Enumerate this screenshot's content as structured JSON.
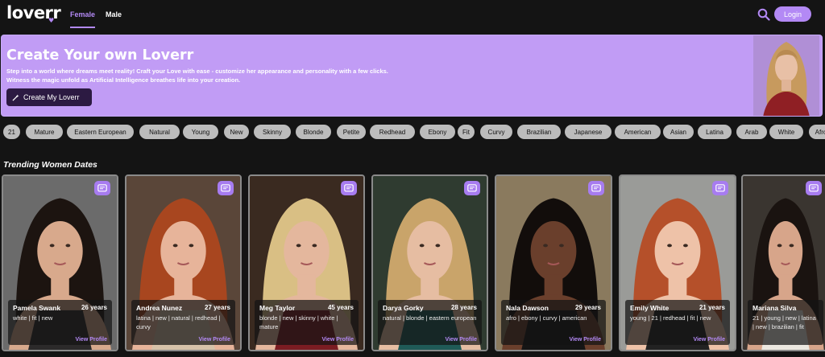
{
  "brand": {
    "logo": "loverr"
  },
  "nav": {
    "tabs": [
      "Female",
      "Male"
    ],
    "active": "Female",
    "login_label": "Login"
  },
  "hero": {
    "title": "Create Your own Loverr",
    "line1": "Step into a world where dreams meet reality! Craft your Love with ease - customize her appearance and personality with a few clicks.",
    "line2": "Witness the magic unfold as Artificial Intelligence breathes life into your creation.",
    "cta_label": "Create My Loverr"
  },
  "filters": [
    "21",
    "Mature",
    "Eastern European",
    "Natural",
    "Young",
    "New",
    "Skinny",
    "Blonde",
    "Petite",
    "Redhead",
    "Ebony",
    "Fit",
    "Curvy",
    "Brazilian",
    "Japanese",
    "American",
    "Asian",
    "Latina",
    "Arab",
    "White",
    "Afro"
  ],
  "section": {
    "title": "Trending Women Dates"
  },
  "cards": [
    {
      "name": "Pamela Swank",
      "age": "26 years",
      "tags": "white | fit | new",
      "view": "View Profile",
      "hair": "#1c1410",
      "skin": "#d8a98c",
      "bg": "#6b6b6b",
      "top": "#2c2a2a"
    },
    {
      "name": "Andrea Nunez",
      "age": "27 years",
      "tags": "latina | new | natural | redhead | curvy",
      "view": "View Profile",
      "hair": "#a8461f",
      "skin": "#e7b49a",
      "bg": "#5a4639",
      "top": "#d6c2a9"
    },
    {
      "name": "Meg Taylor",
      "age": "45 years",
      "tags": "blonde | new | skinny | white | mature",
      "view": "View Profile",
      "hair": "#d9bf84",
      "skin": "#e4b79d",
      "bg": "#3a2a20",
      "top": "#7a1c22"
    },
    {
      "name": "Darya Gorky",
      "age": "28 years",
      "tags": "natural | blonde | eastern european",
      "view": "View Profile",
      "hair": "#c9a46a",
      "skin": "#e6bda2",
      "bg": "#2f3b30",
      "top": "#1f5a57"
    },
    {
      "name": "Nala Dawson",
      "age": "29 years",
      "tags": "afro | ebony | curvy | american",
      "view": "View Profile",
      "hair": "#120d0b",
      "skin": "#6a3f2c",
      "bg": "#8a7a5e",
      "top": "#151515"
    },
    {
      "name": "Emily White",
      "age": "21 years",
      "tags": "young | 21 | redhead | fit | new",
      "view": "View Profile",
      "hair": "#b5502a",
      "skin": "#eec2a8",
      "bg": "#9a9b98",
      "top": "#222222"
    },
    {
      "name": "Mariana Silva",
      "age": "",
      "tags": "21 | young | new | latina | new | brazilian | fit",
      "view": "",
      "hair": "#1a1310",
      "skin": "#d7a58a",
      "bg": "#3a3530",
      "top": "#ece8e0"
    }
  ],
  "colors": {
    "accent": "#b389f5",
    "hero_bg": "#c19cf5",
    "page_bg": "#141414",
    "chip_bg": "#bcbcbc"
  },
  "icons": {
    "search": "search-icon",
    "chat": "chat-icon",
    "wand": "wand-icon"
  }
}
